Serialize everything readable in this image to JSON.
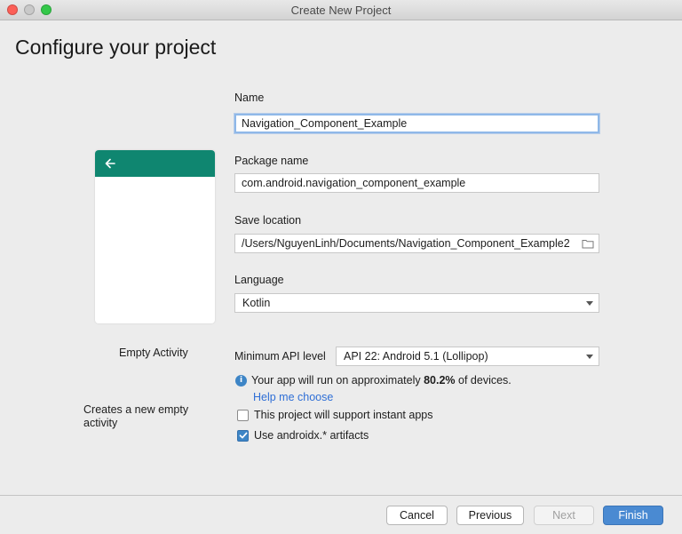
{
  "window": {
    "title": "Create New Project"
  },
  "page": {
    "title": "Configure your project"
  },
  "template": {
    "name": "Empty Activity",
    "description": "Creates a new empty activity",
    "accent_color": "#0f8670"
  },
  "form": {
    "name": {
      "label": "Name",
      "value": "Navigation_Component_Example"
    },
    "package": {
      "label": "Package name",
      "value": "com.android.navigation_component_example"
    },
    "save_location": {
      "label": "Save location",
      "value": "/Users/NguyenLinh/Documents/Navigation_Component_Example2"
    },
    "language": {
      "label": "Language",
      "value": "Kotlin"
    },
    "min_api": {
      "label": "Minimum API level",
      "value": "API 22: Android 5.1 (Lollipop)"
    },
    "info": {
      "before": "Your app will run on approximately ",
      "percent": "80.2%",
      "after": " of devices."
    },
    "help_link": "Help me choose",
    "instant_apps": {
      "label": "This project will support instant apps",
      "checked": false
    },
    "androidx": {
      "label": "Use androidx.* artifacts",
      "checked": true
    }
  },
  "buttons": {
    "cancel": "Cancel",
    "previous": "Previous",
    "next": "Next",
    "finish": "Finish"
  }
}
